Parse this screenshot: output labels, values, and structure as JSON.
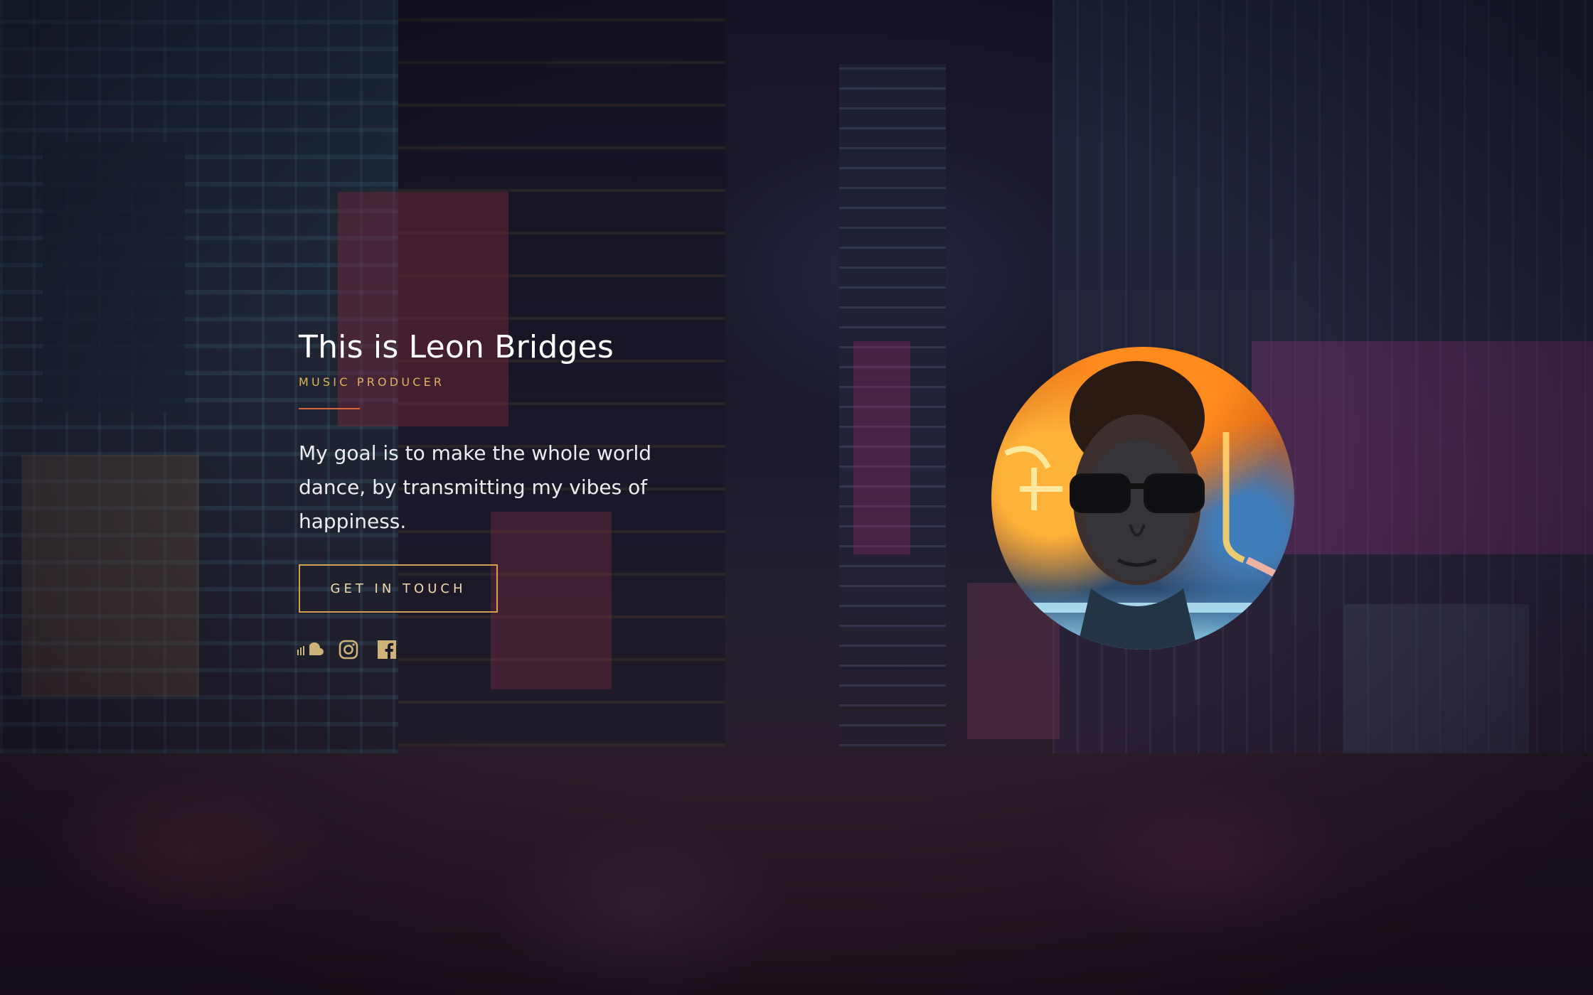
{
  "hero": {
    "headline": "This is Leon Bridges",
    "subtitle": "MUSIC PRODUCER",
    "bio": "My goal is to make the whole world dance, by transmitting my vibes of happiness.",
    "cta_label": "GET IN TOUCH"
  },
  "socials": [
    {
      "icon": "soundcloud-icon"
    },
    {
      "icon": "instagram-icon"
    },
    {
      "icon": "facebook-icon"
    }
  ],
  "colors": {
    "accent": "#e0b35a",
    "divider": "#d8663a",
    "button_border": "#d4a050",
    "icon": "#cdb27a"
  }
}
